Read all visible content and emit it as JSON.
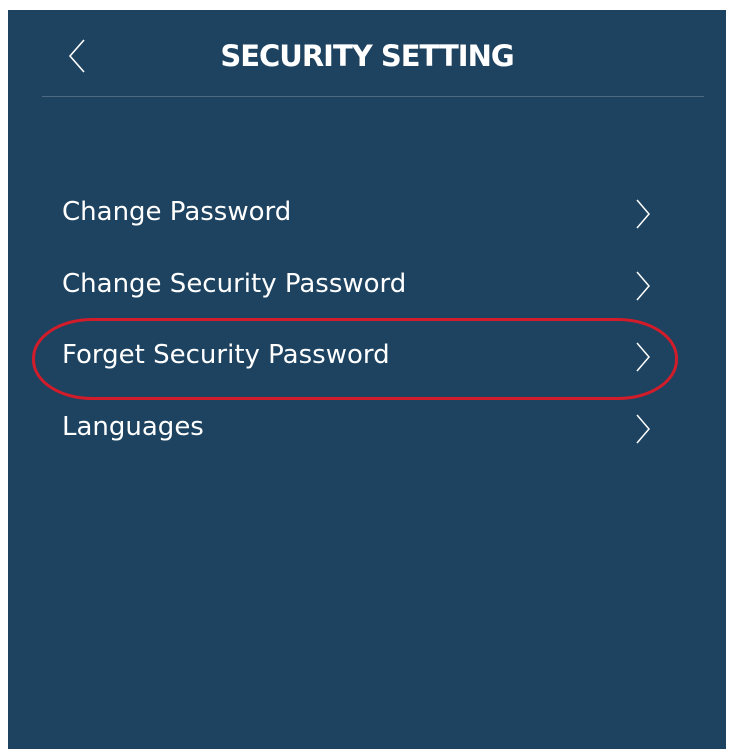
{
  "header": {
    "title": "SECURITY SETTING",
    "back_icon": "chevron-left-icon"
  },
  "menu": {
    "items": [
      {
        "label": "Change Password",
        "icon": "chevron-right-icon"
      },
      {
        "label": "Change Security Password",
        "icon": "chevron-right-icon"
      },
      {
        "label": "Forget Security Password",
        "icon": "chevron-right-icon",
        "highlighted": true
      },
      {
        "label": "Languages",
        "icon": "chevron-right-icon"
      }
    ]
  },
  "colors": {
    "background": "#1e4360",
    "text": "#ffffff",
    "divider": "#4d6a82",
    "highlight": "#d21c2a"
  }
}
